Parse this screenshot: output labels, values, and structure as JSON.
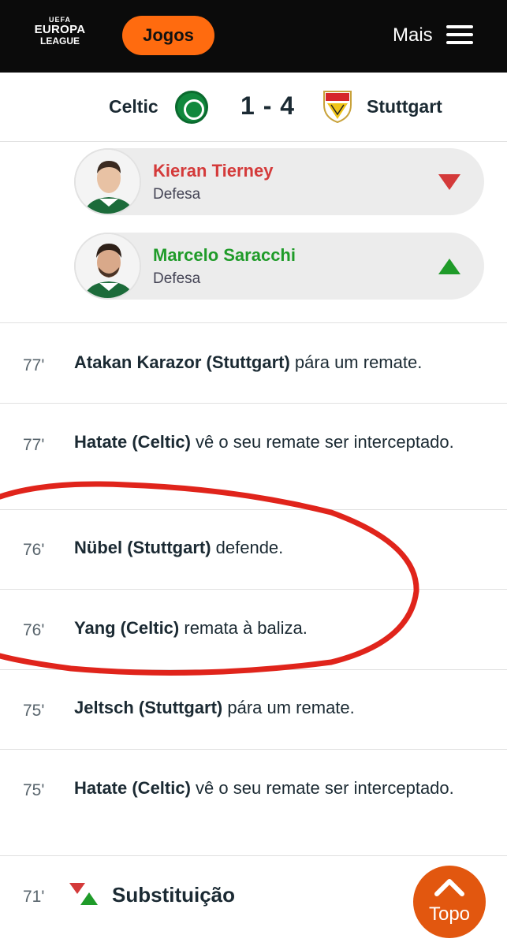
{
  "header": {
    "logo": {
      "line1": "UEFA",
      "line2": "EUROPA",
      "line3": "LEAGUE"
    },
    "games_button": "Jogos",
    "more_label": "Mais"
  },
  "match": {
    "home_team": "Celtic",
    "score": "1 - 4",
    "away_team": "Stuttgart"
  },
  "substitution_players": [
    {
      "name": "Kieran Tierney",
      "position": "Defesa",
      "direction": "out",
      "color": "#d43a3a"
    },
    {
      "name": "Marcelo Saracchi",
      "position": "Defesa",
      "direction": "in",
      "color": "#1f9b29"
    }
  ],
  "events": [
    {
      "minute": "77'",
      "subject": "Atakan Karazor (Stuttgart)",
      "text": " pára um remate."
    },
    {
      "minute": "77'",
      "subject": "Hatate (Celtic)",
      "text": " vê o seu remate ser interceptado."
    },
    {
      "minute": "76'",
      "subject": "Nübel (Stuttgart)",
      "text": " defende."
    },
    {
      "minute": "76'",
      "subject": "Yang (Celtic)",
      "text": " remata à baliza."
    },
    {
      "minute": "75'",
      "subject": "Jeltsch (Stuttgart)",
      "text": " pára um remate."
    },
    {
      "minute": "75'",
      "subject": "Hatate (Celtic)",
      "text": " vê o seu remate ser interceptado."
    }
  ],
  "substitution_event": {
    "minute": "71'",
    "title": "Substituição"
  },
  "top_button": "Topo",
  "colors": {
    "accent": "#ff6b0f",
    "top_button": "#e2570f",
    "annotation": "#e0241b",
    "header_bg": "#0b0b0b"
  }
}
